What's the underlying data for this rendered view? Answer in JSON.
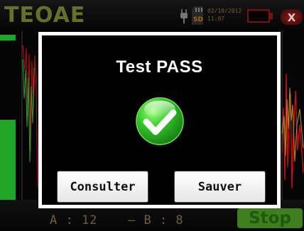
{
  "header": {
    "logo": "TEOAE",
    "sd_label": "SD",
    "date": "02/10/2012",
    "time": "11:07",
    "close_label": "X"
  },
  "dialog": {
    "title": "Test PASS",
    "icon": "check-icon",
    "buttons": {
      "consult": "Consulter",
      "save": "Sauver"
    }
  },
  "bottom": {
    "result_a": "A : 12",
    "result_b": "– B : 8",
    "stop_label": "Stop"
  },
  "colors": {
    "dialog_border": "#ffffff",
    "pass_green": "#2fbe2a",
    "close_red": "#8f1a18",
    "stop_green": "#3f7e1e"
  }
}
